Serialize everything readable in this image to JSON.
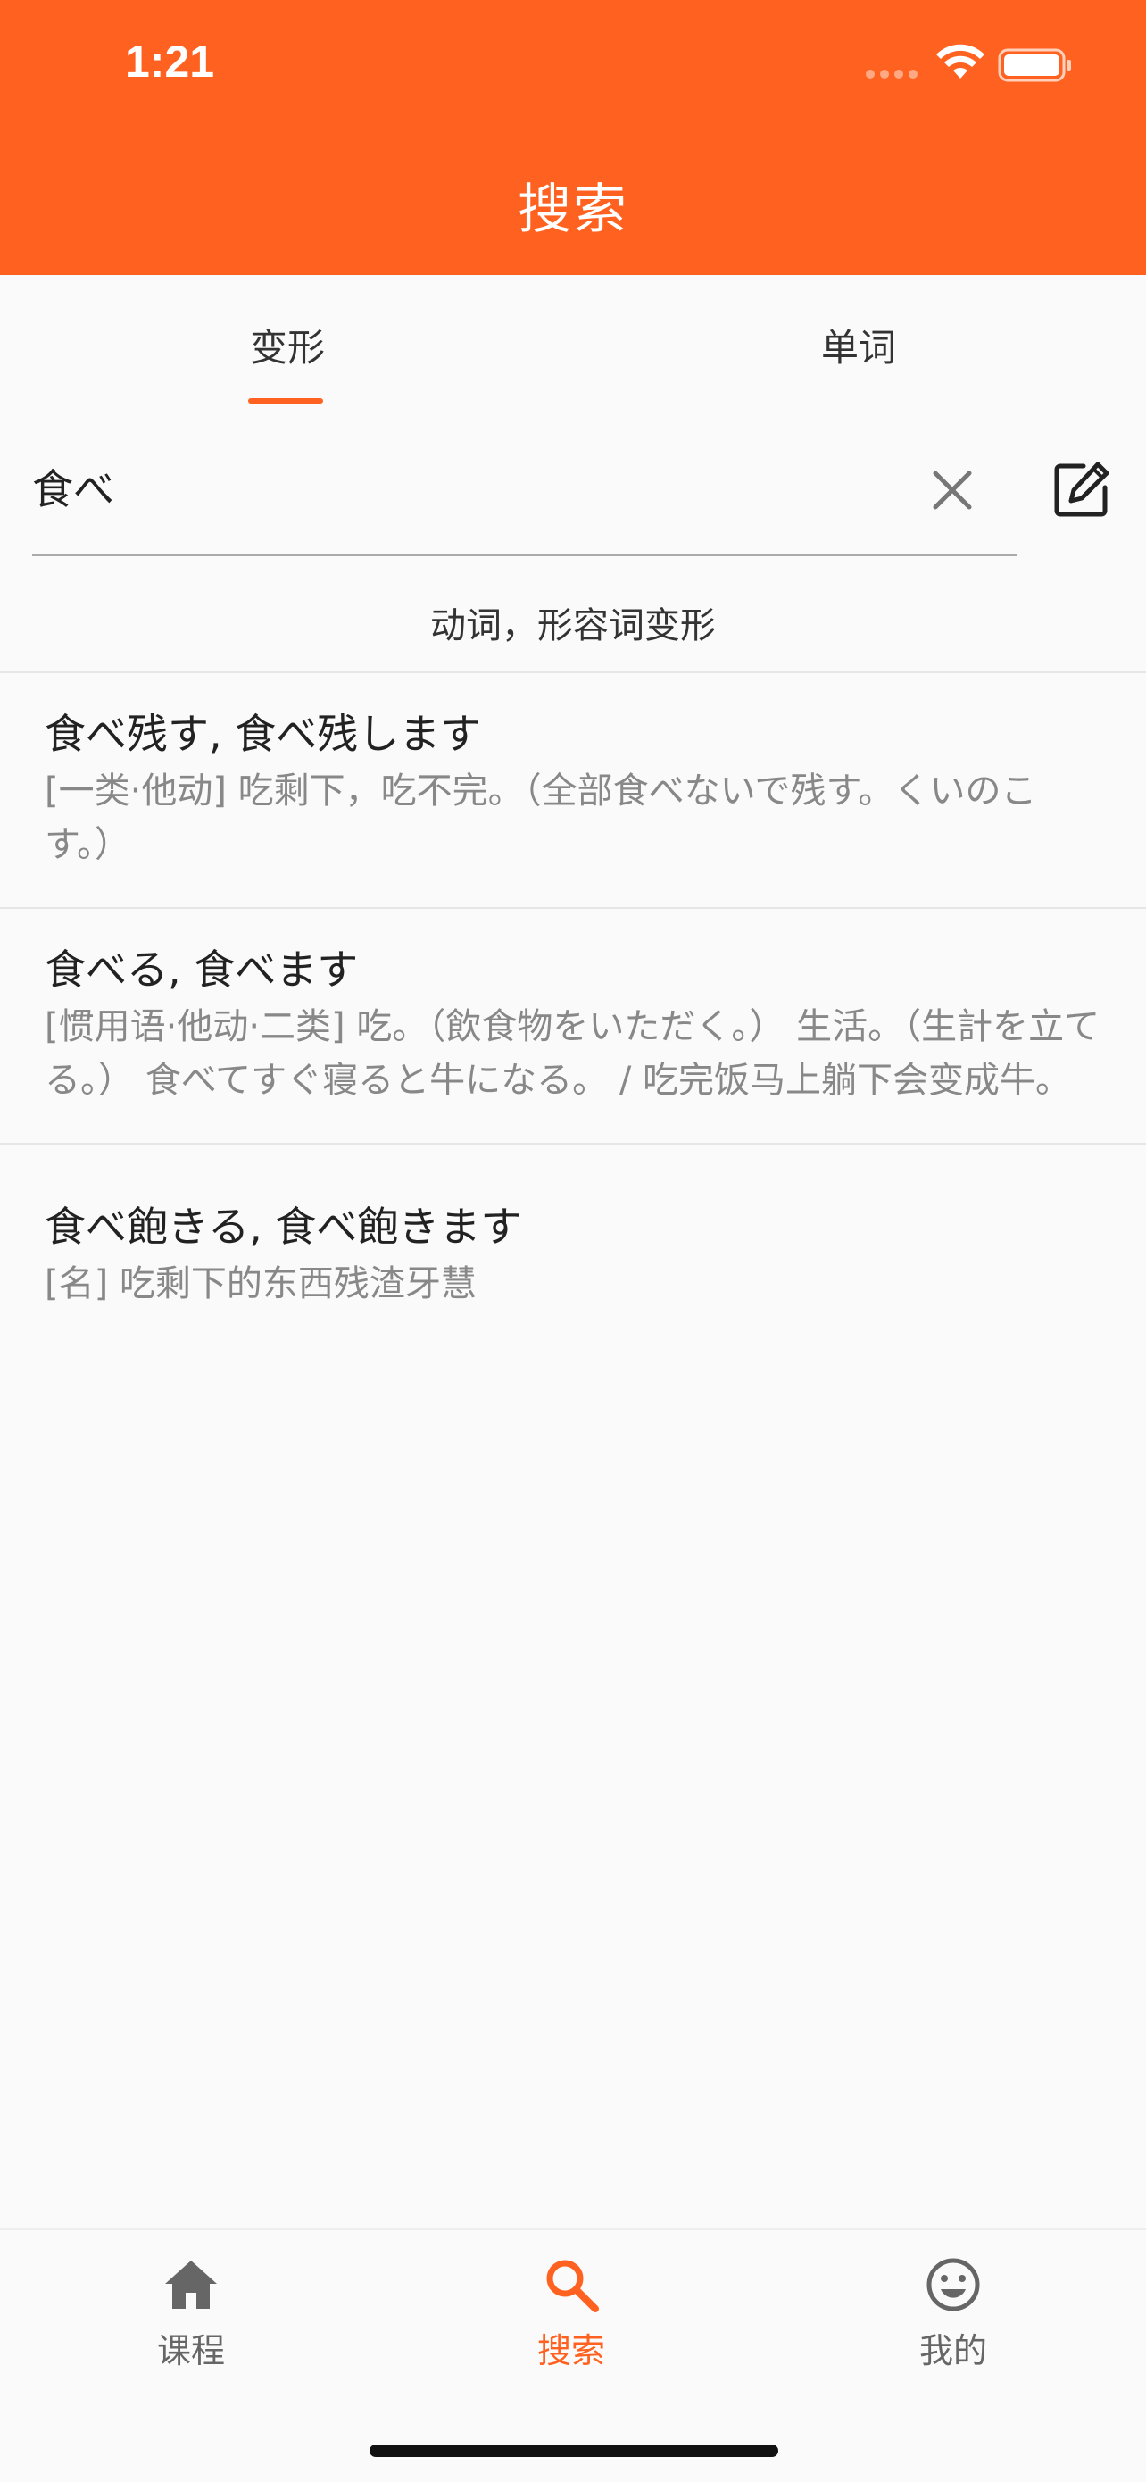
{
  "status_bar": {
    "time": "1:21"
  },
  "header": {
    "title": "搜索"
  },
  "tabs": [
    {
      "label": "变形",
      "active": true
    },
    {
      "label": "单词",
      "active": false
    }
  ],
  "search": {
    "value": "食べ",
    "placeholder": ""
  },
  "section": {
    "label": "动词，形容词变形"
  },
  "results": [
    {
      "title": "食べ残す, 食べ残します",
      "description": "[一类·他动] 吃剩下，吃不完。（全部食べないで残す。くいのこす。）"
    },
    {
      "title": "食べる, 食べます",
      "description": "[惯用语·他动·二类] 吃。（飲食物をいただく。） 生活。（生計を立てる。） 食べてすぐ寝ると牛になる。 / 吃完饭马上躺下会变成牛。"
    },
    {
      "title": "食べ飽きる, 食べ飽きます",
      "description": "[名] 吃剩下的东西残渣牙慧"
    }
  ],
  "tabbar": [
    {
      "label": "课程",
      "icon": "home-icon",
      "active": false
    },
    {
      "label": "搜索",
      "icon": "search-icon",
      "active": true
    },
    {
      "label": "我的",
      "icon": "smiley-icon",
      "active": false
    }
  ],
  "colors": {
    "accent": "#ff6220",
    "background": "#fafafa",
    "text": "#222222",
    "secondary_text": "#888888"
  }
}
